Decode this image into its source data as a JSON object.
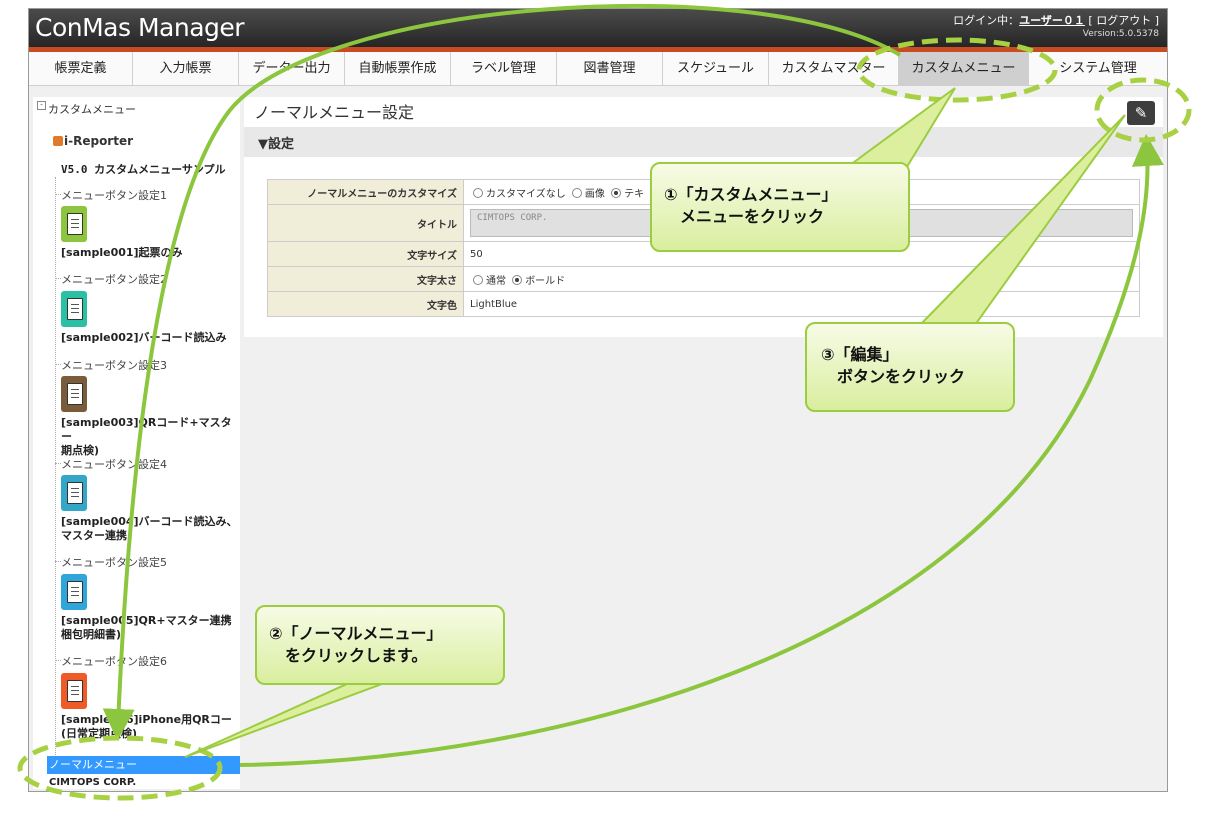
{
  "header": {
    "logo": "ConMas Manager",
    "login_prefix": "ログイン中：",
    "user": "ユーザー０１",
    "logout": "[ ログアウト ]",
    "version": "Version:5.0.5378"
  },
  "nav": {
    "tabs": [
      {
        "label": "帳票定義"
      },
      {
        "label": "入力帳票"
      },
      {
        "label": "データー出力"
      },
      {
        "label": "自動帳票作成"
      },
      {
        "label": "ラベル管理"
      },
      {
        "label": "図書管理"
      },
      {
        "label": "スケジュール"
      },
      {
        "label": "カスタムマスター"
      },
      {
        "label": "カスタムメニュー",
        "active": true
      },
      {
        "label": "システム管理"
      }
    ]
  },
  "sidebar": {
    "root": "カスタムメニュー",
    "ireporter": "i-Reporter",
    "sample_title": "V5.0 カスタムメニューサンプル",
    "items": [
      {
        "setting": "メニューボタン設定1",
        "label": "[sample001]起票のみ",
        "color": "#8cc63e"
      },
      {
        "setting": "メニューボタン設定2",
        "label": "[sample002]バーコード読込み",
        "color": "#2bbfa3"
      },
      {
        "setting": "メニューボタン設定3",
        "label": "[sample003]QRコード+マスター\n期点検)",
        "color": "#7a5c3b"
      },
      {
        "setting": "メニューボタン設定4",
        "label": "[sample004]バーコード読込み、\nマスター連携",
        "color": "#34a7c9"
      },
      {
        "setting": "メニューボタン設定5",
        "label": "[sample005]QR+マスター連携\n梱包明細書)",
        "color": "#2ea6d9"
      },
      {
        "setting": "メニューボタン設定6",
        "label": "[sample006]iPhone用QRコー\n(日常定期点検)",
        "color": "#ef5a27"
      }
    ],
    "selected": "ノーマルメニュー",
    "selected_sub": "CIMTOPS CORP."
  },
  "main": {
    "title": "ノーマルメニュー設定",
    "section": "▼設定",
    "edit_icon": "edit-icon",
    "rows": {
      "customize_label": "ノーマルメニューのカスタマイズ",
      "customize_options": [
        "カスタマイズなし",
        "画像",
        "テキ"
      ],
      "title_label": "タイトル",
      "title_value": "CIMTOPS CORP.",
      "fontsize_label": "文字サイズ",
      "fontsize_value": "50",
      "weight_label": "文字太さ",
      "weight_options": [
        "通常",
        "ボールド"
      ],
      "color_label": "文字色",
      "color_value": "LightBlue"
    }
  },
  "callouts": {
    "c1": "①「カスタムメニュー」\n　メニューをクリック",
    "c2": "②「ノーマルメニュー」\n　をクリックします。",
    "c3": "③「編集」\n　ボタンをクリック"
  }
}
